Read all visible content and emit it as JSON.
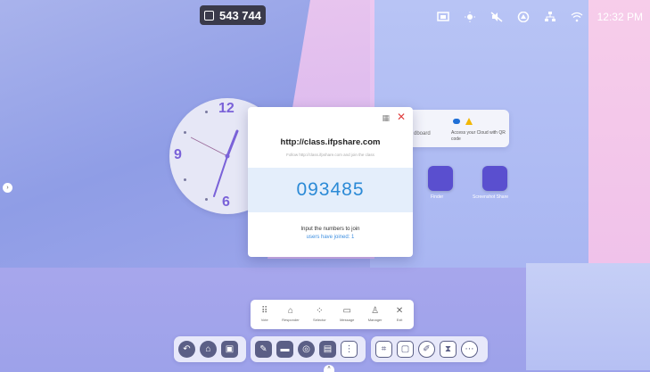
{
  "top_badge": {
    "code": "543 744",
    "icon": "screen-share-icon"
  },
  "status_bar": {
    "icons": [
      "cast-icon",
      "brightness-icon",
      "mute-icon",
      "cloud-icon",
      "network-icon",
      "wifi-icon"
    ],
    "time": "12:32 PM"
  },
  "clock": {
    "numerals": [
      "12",
      "9",
      "6"
    ]
  },
  "cloud_card": {
    "left_text": "dboard",
    "right_text": "Access your Cloud with QR code"
  },
  "desktop_icons": [
    {
      "label": "Finder",
      "icon": "wallet-icon"
    },
    {
      "label": "Screenshot Share",
      "icon": "cast-screen-icon"
    }
  ],
  "dialog": {
    "url": "http://class.ifpshare.com",
    "hint": "Follow http://class.ifpshare.com and join the class",
    "code": "093485",
    "instruction": "Input the numbers to join",
    "joined": "users have joined: 1",
    "qr_icon": "qr-code-icon",
    "close_icon": "close-icon"
  },
  "tools": [
    {
      "label": "Vote",
      "icon": "vote-icon"
    },
    {
      "label": "Responder",
      "icon": "responder-icon"
    },
    {
      "label": "Selector",
      "icon": "selector-icon"
    },
    {
      "label": "Message",
      "icon": "message-icon"
    },
    {
      "label": "Manager",
      "icon": "manager-icon"
    },
    {
      "label": "Exit",
      "icon": "exit-icon"
    }
  ],
  "dock": {
    "group1": [
      "back-icon",
      "home-icon",
      "window-icon"
    ],
    "group2": [
      "whiteboard-icon",
      "files-icon",
      "browser-icon",
      "screen-share-icon",
      "apps-icon"
    ],
    "group3": [
      "crop-icon",
      "screenshot-icon",
      "pen-icon",
      "timer-icon",
      "more-icon"
    ]
  }
}
